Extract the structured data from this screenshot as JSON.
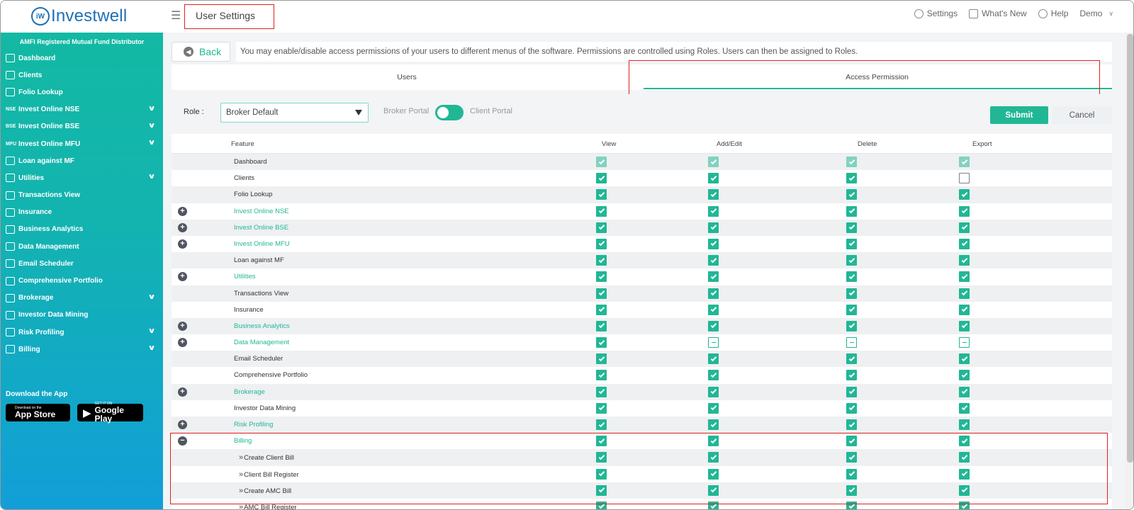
{
  "header": {
    "logo_text": "Investwell",
    "logo_mark": "iW",
    "page_title": "User Settings",
    "links": [
      {
        "label": "Settings",
        "icon": "gear-icon"
      },
      {
        "label": "What's New",
        "icon": "news-icon"
      },
      {
        "label": "Help",
        "icon": "help-icon"
      },
      {
        "label": "Demo",
        "icon": "user-menu-chevron"
      }
    ]
  },
  "sidebar": {
    "tagline": "AMFI Registered Mutual Fund Distributor",
    "items": [
      {
        "label": "Dashboard",
        "tag": "",
        "expandable": false
      },
      {
        "label": "Clients",
        "tag": "",
        "expandable": false
      },
      {
        "label": "Folio Lookup",
        "tag": "",
        "expandable": false
      },
      {
        "label": "Invest Online NSE",
        "tag": "NSE",
        "expandable": true
      },
      {
        "label": "Invest Online BSE",
        "tag": "BSE",
        "expandable": true
      },
      {
        "label": "Invest Online MFU",
        "tag": "MFU",
        "expandable": true
      },
      {
        "label": "Loan against MF",
        "tag": "",
        "expandable": false
      },
      {
        "label": "Utilities",
        "tag": "",
        "expandable": true
      },
      {
        "label": "Transactions View",
        "tag": "",
        "expandable": false
      },
      {
        "label": "Insurance",
        "tag": "",
        "expandable": false
      },
      {
        "label": "Business Analytics",
        "tag": "",
        "expandable": false
      },
      {
        "label": "Data Management",
        "tag": "",
        "expandable": false
      },
      {
        "label": "Email Scheduler",
        "tag": "",
        "expandable": false
      },
      {
        "label": "Comprehensive Portfolio",
        "tag": "",
        "expandable": false
      },
      {
        "label": "Brokerage",
        "tag": "",
        "expandable": true
      },
      {
        "label": "Investor Data Mining",
        "tag": "",
        "expandable": false
      },
      {
        "label": "Risk Profiling",
        "tag": "",
        "expandable": true
      },
      {
        "label": "Billing",
        "tag": "",
        "expandable": true
      }
    ],
    "download_title": "Download the App",
    "app_store": {
      "small": "Download on the",
      "big": "App Store"
    },
    "google_play": {
      "small": "GET IT ON",
      "big": "Google Play"
    }
  },
  "toolbar": {
    "back_label": "Back",
    "info_text": "You may enable/disable access permissions of your users to different menus of the software. Permissions are controlled using Roles. Users can then be assigned to Roles."
  },
  "tabs": {
    "users": "Users",
    "access": "Access Permission",
    "active": "access"
  },
  "role": {
    "label": "Role :",
    "selected": "Broker Default",
    "broker_portal": "Broker Portal",
    "client_portal": "Client Portal",
    "toggle_on": true,
    "submit": "Submit",
    "cancel": "Cancel"
  },
  "table": {
    "headers": {
      "feature": "Feature",
      "view": "View",
      "add_edit": "Add/Edit",
      "delete": "Delete",
      "export": "Export"
    },
    "rows": [
      {
        "feature": "Dashboard",
        "type": "plain",
        "expander": "",
        "view": "dim",
        "add": "dim",
        "del": "dim",
        "exp": "dim"
      },
      {
        "feature": "Clients",
        "type": "plain",
        "expander": "",
        "view": "on",
        "add": "on",
        "del": "on",
        "exp": "off"
      },
      {
        "feature": "Folio Lookup",
        "type": "plain",
        "expander": "",
        "view": "on",
        "add": "on",
        "del": "on",
        "exp": "on"
      },
      {
        "feature": "Invest Online NSE",
        "type": "link",
        "expander": "+",
        "view": "on",
        "add": "on",
        "del": "on",
        "exp": "on"
      },
      {
        "feature": "Invest Online BSE",
        "type": "link",
        "expander": "+",
        "view": "on",
        "add": "on",
        "del": "on",
        "exp": "on"
      },
      {
        "feature": "Invest Online MFU",
        "type": "link",
        "expander": "+",
        "view": "on",
        "add": "on",
        "del": "on",
        "exp": "on"
      },
      {
        "feature": "Loan against MF",
        "type": "plain",
        "expander": "",
        "view": "on",
        "add": "on",
        "del": "on",
        "exp": "on"
      },
      {
        "feature": "Utilities",
        "type": "link",
        "expander": "+",
        "view": "on",
        "add": "on",
        "del": "on",
        "exp": "on"
      },
      {
        "feature": "Transactions View",
        "type": "plain",
        "expander": "",
        "view": "on",
        "add": "on",
        "del": "on",
        "exp": "on"
      },
      {
        "feature": "Insurance",
        "type": "plain",
        "expander": "",
        "view": "on",
        "add": "on",
        "del": "on",
        "exp": "on"
      },
      {
        "feature": "Business Analytics",
        "type": "link",
        "expander": "+",
        "view": "on",
        "add": "on",
        "del": "on",
        "exp": "on"
      },
      {
        "feature": "Data Management",
        "type": "link",
        "expander": "+",
        "view": "on",
        "add": "partial",
        "del": "partial",
        "exp": "partial"
      },
      {
        "feature": "Email Scheduler",
        "type": "plain",
        "expander": "",
        "view": "on",
        "add": "on",
        "del": "on",
        "exp": "on"
      },
      {
        "feature": "Comprehensive Portfolio",
        "type": "plain",
        "expander": "",
        "view": "on",
        "add": "on",
        "del": "on",
        "exp": "on"
      },
      {
        "feature": "Brokerage",
        "type": "link",
        "expander": "+",
        "view": "on",
        "add": "on",
        "del": "on",
        "exp": "on"
      },
      {
        "feature": "Investor Data Mining",
        "type": "plain",
        "expander": "",
        "view": "on",
        "add": "on",
        "del": "on",
        "exp": "on"
      },
      {
        "feature": "Risk Profiling",
        "type": "link",
        "expander": "+",
        "view": "on",
        "add": "on",
        "del": "on",
        "exp": "on"
      },
      {
        "feature": "Billing",
        "type": "link",
        "expander": "−",
        "view": "on",
        "add": "on",
        "del": "on",
        "exp": "on"
      },
      {
        "feature": "Create Client Bill",
        "type": "sub",
        "expander": "",
        "view": "on",
        "add": "on",
        "del": "on",
        "exp": "on"
      },
      {
        "feature": "Client Bill Register",
        "type": "sub",
        "expander": "",
        "view": "on",
        "add": "on",
        "del": "on",
        "exp": "on"
      },
      {
        "feature": "Create AMC Bill",
        "type": "sub",
        "expander": "",
        "view": "on",
        "add": "on",
        "del": "on",
        "exp": "on"
      },
      {
        "feature": "AMC Bill Register",
        "type": "sub",
        "expander": "",
        "view": "on",
        "add": "on",
        "del": "on",
        "exp": "on"
      }
    ]
  },
  "colors": {
    "accent": "#21b795",
    "highlight_box": "#e02020",
    "sidebar_top": "#13b9a3",
    "sidebar_bottom": "#129ed8"
  }
}
